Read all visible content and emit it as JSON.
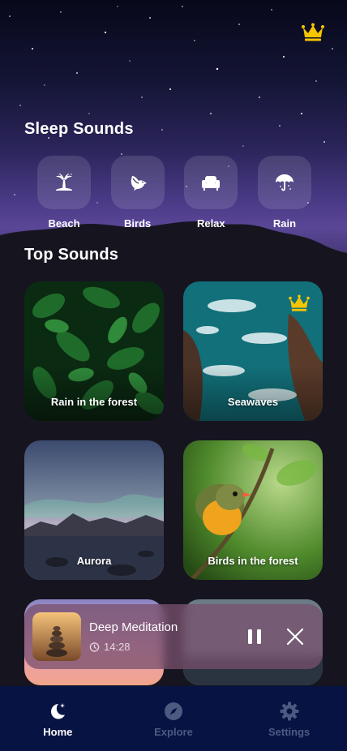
{
  "header": {
    "premium_icon": "crown-icon",
    "crown_color": "#f6c500"
  },
  "sleep_sounds": {
    "title": "Sleep Sounds",
    "categories": [
      {
        "label": "Beach",
        "icon": "palm-tree-icon"
      },
      {
        "label": "Birds",
        "icon": "bird-icon"
      },
      {
        "label": "Relax",
        "icon": "armchair-icon"
      },
      {
        "label": "Rain",
        "icon": "umbrella-icon"
      }
    ]
  },
  "top_sounds": {
    "title": "Top Sounds",
    "cards": [
      {
        "label": "Rain in the forest",
        "premium": false
      },
      {
        "label": "Seawaves",
        "premium": true
      },
      {
        "label": "Aurora",
        "premium": false
      },
      {
        "label": "Birds in the forest",
        "premium": false
      }
    ]
  },
  "player": {
    "title": "Deep Meditation",
    "time": "14:28",
    "pause_icon": "pause-icon",
    "close_icon": "close-icon"
  },
  "nav": {
    "items": [
      {
        "label": "Home",
        "icon": "moon-star-icon",
        "active": true
      },
      {
        "label": "Explore",
        "icon": "compass-icon",
        "active": false
      },
      {
        "label": "Settings",
        "icon": "gear-icon",
        "active": false
      }
    ],
    "active_color": "#ffffff",
    "inactive_color": "#4d5a80",
    "background": "#061343"
  }
}
